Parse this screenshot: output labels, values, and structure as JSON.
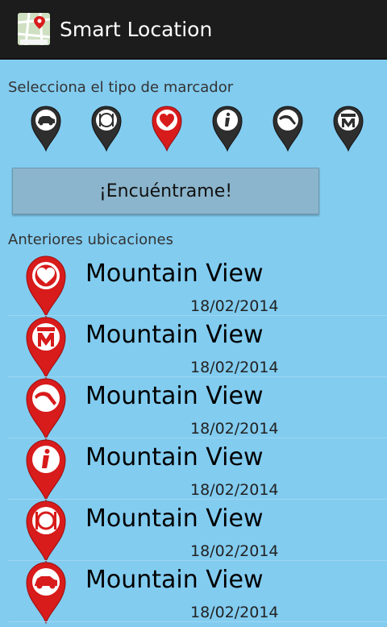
{
  "app": {
    "title": "Smart Location",
    "icon": "map-app-icon"
  },
  "marker_selector": {
    "label": "Selecciona el tipo de marcador",
    "markers": [
      {
        "name": "car",
        "selected": false
      },
      {
        "name": "restaurant",
        "selected": false
      },
      {
        "name": "heart",
        "selected": true
      },
      {
        "name": "info",
        "selected": false
      },
      {
        "name": "gas-station",
        "selected": false
      },
      {
        "name": "metro",
        "selected": false
      }
    ]
  },
  "find_button": {
    "label": "¡Encuéntrame!"
  },
  "history": {
    "label": "Anteriores ubicaciones",
    "items": [
      {
        "name": "Mountain View",
        "date": "18/02/2014",
        "icon": "heart"
      },
      {
        "name": "Mountain View",
        "date": "18/02/2014",
        "icon": "metro"
      },
      {
        "name": "Mountain View",
        "date": "18/02/2014",
        "icon": "gas-station"
      },
      {
        "name": "Mountain View",
        "date": "18/02/2014",
        "icon": "info"
      },
      {
        "name": "Mountain View",
        "date": "18/02/2014",
        "icon": "restaurant"
      },
      {
        "name": "Mountain View",
        "date": "18/02/2014",
        "icon": "car"
      }
    ]
  },
  "colors": {
    "background": "#82CCF0",
    "action_bar": "#1C1C1C",
    "pin_red": "#D81B1B",
    "pin_dark": "#2E2E2E",
    "button": "#8BB5CC"
  }
}
